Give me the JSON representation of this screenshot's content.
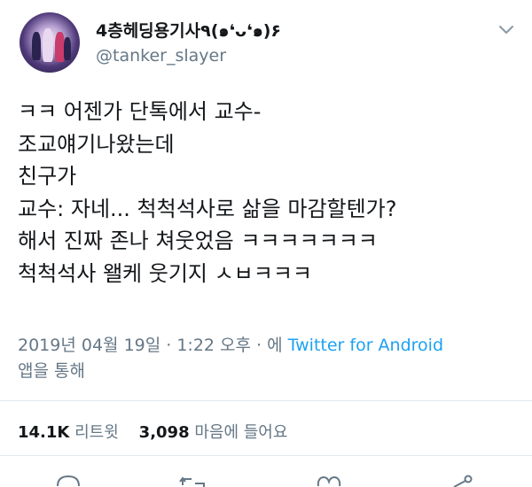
{
  "profile": {
    "display_name": "4층헤딩용기사٩(๑❛ᴗ❛๑)۶",
    "handle": "@tanker_slayer"
  },
  "tweet": {
    "lines": [
      "ㅋㅋ 어젠가 단톡에서 교수-",
      "조교얘기나왔는데",
      "친구가",
      "교수: 자네... 척척석사로 삶을 마감할텐가?",
      "해서 진짜 존나 쳐웃었음 ㅋㅋㅋㅋㅋㅋㅋ",
      "척척석사 왤케 웃기지 ㅅㅂㅋㅋㅋ"
    ]
  },
  "meta": {
    "timestamp": "2019년 04월 19일 · 1:22 오후 · 에",
    "source": "Twitter for Android",
    "via": "앱을 통해"
  },
  "stats": {
    "retweet_count": "14.1K",
    "retweet_label": "리트윗",
    "like_count": "3,098",
    "like_label": "마음에 들어요"
  },
  "colors": {
    "accent": "#1da1f2",
    "secondary_text": "#657786",
    "divider": "#e1e8ed"
  },
  "icons": [
    "chevron-down-icon",
    "reply-icon",
    "retweet-icon",
    "like-icon",
    "share-icon"
  ]
}
